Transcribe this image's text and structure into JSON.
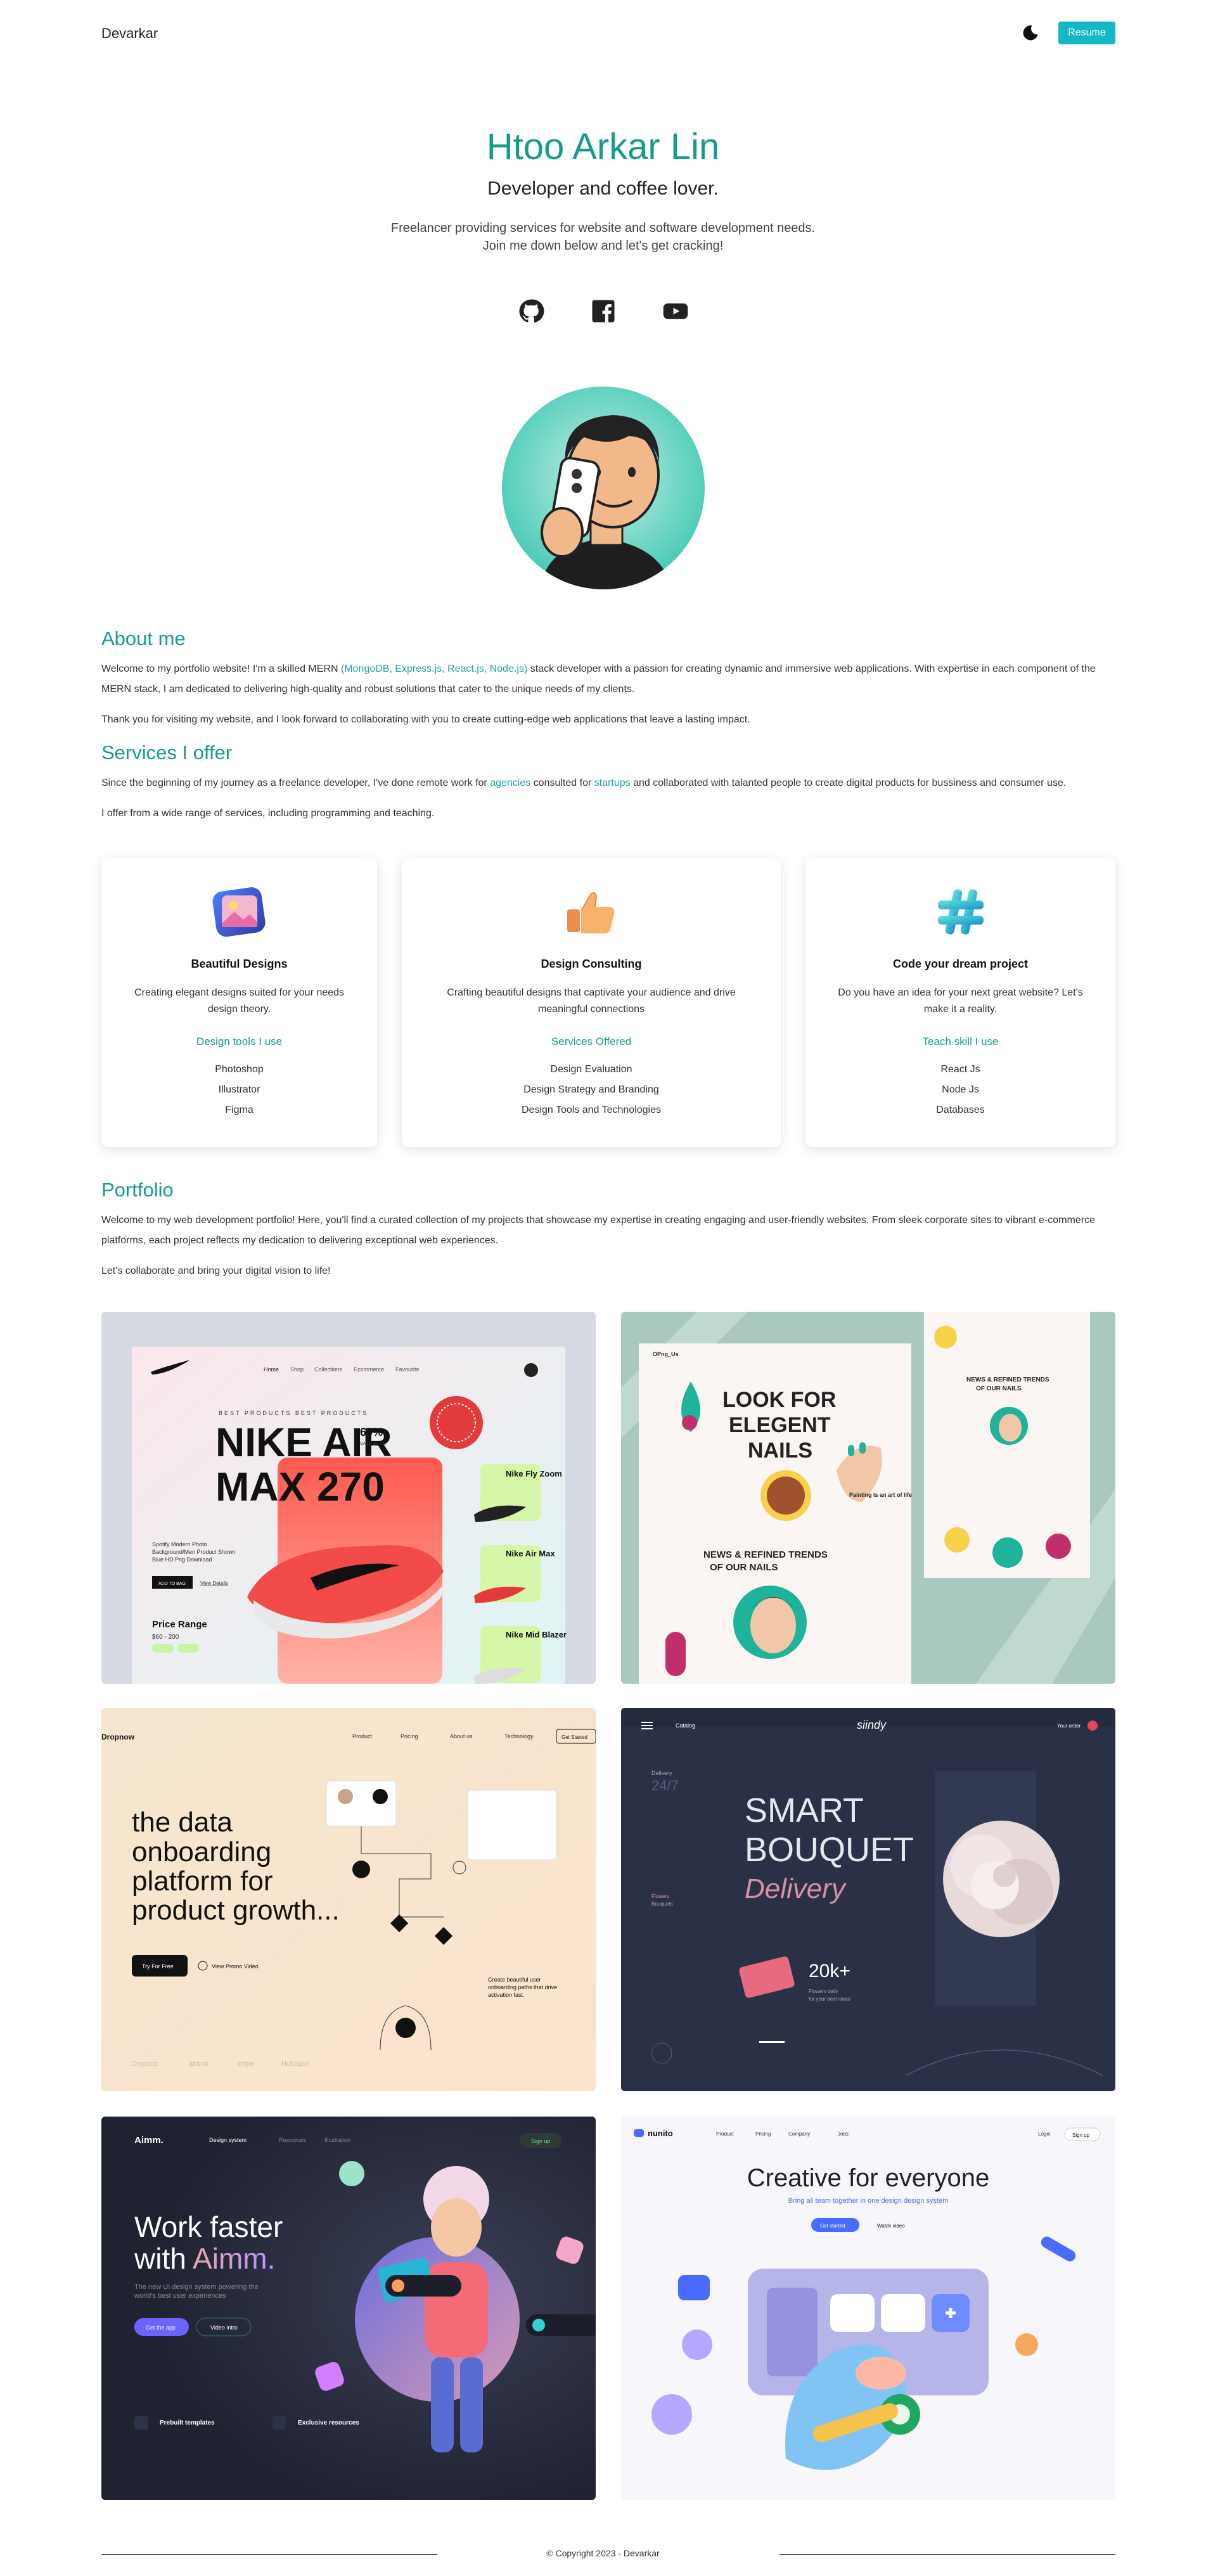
{
  "nav": {
    "brand": "Devarkar",
    "resume_label": "Resume",
    "theme_icon": "moon-icon"
  },
  "hero": {
    "name": "Htoo Arkar Lin",
    "tagline": "Developer and coffee lover.",
    "intro_line1": "Freelancer providing services for website and software development needs.",
    "intro_line2": "Join me down below and let's get cracking!"
  },
  "social": [
    "github-icon",
    "facebook-icon",
    "youtube-icon"
  ],
  "about": {
    "title": "About me",
    "p1_before": "Welcome to my portfolio website! I'm a skilled MERN ",
    "p1_stack": "(MongoDB, Express.js, React.js, Node.js)",
    "p1_after": " stack developer with a passion for creating dynamic and immersive web applications. With expertise in each component of the MERN stack, I am dedicated to delivering high-quality and robust solutions that cater to the unique needs of my clients.",
    "p2": "Thank you for visiting my website, and I look forward to collaborating with you to create cutting-edge web applications that leave a lasting impact."
  },
  "services": {
    "title": "Services I offer",
    "p1_before": "Since the beginning of my journey as a freelance developer, I've done remote work for ",
    "p1_agencies": "agencies",
    "p1_mid": " consulted for ",
    "p1_startups": "startups",
    "p1_after": " and collaborated with talanted people to create digital products for bussiness and consumer use.",
    "p2": "I offer from a wide range of services, including programming and teaching.",
    "cards": [
      {
        "icon": "image-gallery-icon",
        "title": "Beautiful Designs",
        "desc_line1": "Creating elegant designs suited for your needs",
        "desc_line2": "design theory.",
        "subtitle": "Design tools I use",
        "items": [
          "Photoshop",
          "Illustrator",
          "Figma"
        ]
      },
      {
        "icon": "thumbs-up-icon",
        "title": "Design Consulting",
        "desc_line1": "Crafting beautiful designs that captivate your audience and drive",
        "desc_line2": "meaningful connections",
        "subtitle": "Services Offered",
        "items": [
          "Design Evaluation",
          "Design Strategy and Branding",
          "Design Tools and Technologies"
        ]
      },
      {
        "icon": "hashtag-icon",
        "title": "Code your dream project",
        "desc_line1": "Do you have an idea for your next great website? Let's",
        "desc_line2": "make it a reality.",
        "subtitle": "Teach skill I use",
        "items": [
          "React Js",
          "Node Js",
          "Databases"
        ]
      }
    ]
  },
  "portfolio": {
    "title": "Portfolio",
    "p1": "Welcome to my web development portfolio! Here, you'll find a curated collection of my projects that showcase my expertise in creating engaging and user-friendly websites. From sleek corporate sites to vibrant e-commerce platforms, each project reflects my dedication to delivering exceptional web experiences.",
    "p2": "Let's collaborate and bring your digital vision to life!",
    "projects": [
      {
        "nav": [
          "Home",
          "Shop",
          "Collections",
          "Ecommerce",
          "Favourite"
        ],
        "kicker": "BEST PRODUCTS BEST PRODUCTS",
        "headline_1": "NIKE AIR",
        "headline_2": "MAX 270",
        "discount": "60%",
        "discount_sub": "SAVE UP TO",
        "desc_1": "Spotify Modern Photo",
        "desc_2": "Background/Men Product Shown",
        "desc_3": "Blue HD Png Download",
        "add_to_bag": "ADD TO BAG",
        "view_details": "View Details",
        "price_title": "Price Range",
        "price_value": "$60 - 200",
        "side_items": [
          "Nike Fly Zoom",
          "Nike Air Max",
          "Nike Mid Blazer"
        ],
        "shop_now": "SHOP NOW"
      },
      {
        "brand": "OPng_Us",
        "headline_1": "LOOK FOR",
        "headline_2": "ELEGENT",
        "headline_3": "NAILS",
        "tag": "Painting is an art of life",
        "news_1": "NEWS & REFINED TRENDS",
        "news_2": "OF OUR NAILS",
        "side_news_1": "NEWS & REFINED TRENDS",
        "side_news_2": "OF OUR NAILS"
      },
      {
        "brand": "Dropnow",
        "nav": [
          "Product",
          "Pricing",
          "About us",
          "Technology"
        ],
        "nav_cta": "Get Started",
        "headline_1": "the data",
        "headline_2": "onboarding",
        "headline_3": "platform for",
        "headline_4": "product growth...",
        "cta": "Try For Free",
        "secondary": "View Promo Video",
        "note_1": "Create beautiful user",
        "note_2": "onboarding paths that drive",
        "note_3": "activation fast.",
        "logos": [
          "Dropbox",
          "airbnb",
          "stripe",
          "HubSpot"
        ]
      },
      {
        "nav_left": "Catalog",
        "brand": "siindy",
        "nav_right": "Your order",
        "delivery": "Delivery",
        "delivery_time": "24/7",
        "headline_1": "SMART",
        "headline_2": "BOUQUET",
        "headline_script": "Delivery",
        "side_label_1": "Flowers",
        "side_label_2": "Bouquets",
        "price": "20k+",
        "price_sub_1": "Flowers daily",
        "price_sub_2": "for your best ideas"
      },
      {
        "brand": "Aimm.",
        "nav": [
          "Design system",
          "Resources",
          "Illustration"
        ],
        "nav_cta": "Sign up",
        "headline_1": "Work faster",
        "headline_2a": "with ",
        "headline_2b": "Aimm.",
        "sub_1": "The new UI design system powering the",
        "sub_2": "world's best user experiences",
        "cta": "Get the app",
        "secondary": "Video intro",
        "feature_1": "Prebuilt templates",
        "feature_2": "Exclusive resources"
      },
      {
        "brand": "nunito",
        "nav": [
          "Product",
          "Pricing",
          "Company",
          "Jobs"
        ],
        "login": "Login",
        "signup": "Sign up",
        "headline": "Creative for everyone",
        "sub": "Bring all team together in one design design system",
        "cta": "Get started",
        "secondary": "Watch video"
      }
    ]
  },
  "footer": {
    "text": "© Copyright 2023 - Devarkar"
  },
  "colors": {
    "accent": "#169c8c",
    "button": "#14b8c4"
  }
}
